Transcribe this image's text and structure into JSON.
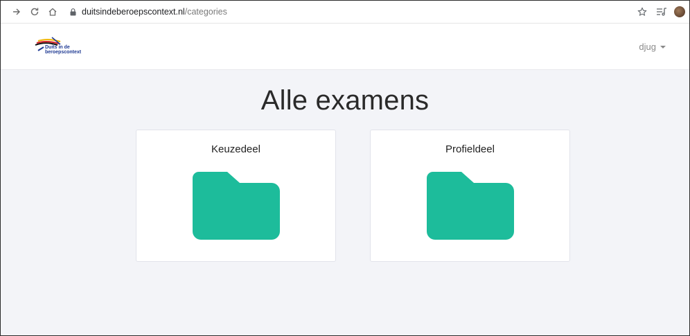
{
  "browser": {
    "url_domain": "duitsindeberoepscontext.nl",
    "url_path": "/categories",
    "icons": [
      "forward-icon",
      "reload-icon",
      "home-icon",
      "lock-icon",
      "star-icon",
      "reading-list-icon",
      "profile-avatar"
    ]
  },
  "header": {
    "logo_text_line1": "Duits in de",
    "logo_text_line2": "beroepscontext",
    "user_name": "djug"
  },
  "main": {
    "title": "Alle examens",
    "categories": [
      {
        "label": "Keuzedeel",
        "icon": "folder-icon"
      },
      {
        "label": "Profieldeel",
        "icon": "folder-icon"
      }
    ]
  },
  "colors": {
    "folder": "#1dbc9b",
    "background": "#f3f4f8",
    "card": "#ffffff"
  }
}
